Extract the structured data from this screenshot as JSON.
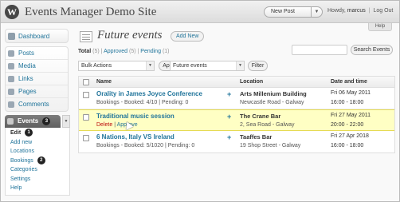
{
  "header": {
    "site_title": "Events Manager Demo Site",
    "new_post": "New Post",
    "howdy_prefix": "Howdy,",
    "username": "marcus",
    "logout": "Log Out",
    "help": "Help"
  },
  "sidebar": {
    "dashboard": "Dashboard",
    "items": [
      {
        "label": "Posts"
      },
      {
        "label": "Media"
      },
      {
        "label": "Links"
      },
      {
        "label": "Pages"
      },
      {
        "label": "Comments"
      }
    ],
    "events": {
      "label": "Events",
      "badge": "3"
    },
    "submenu": [
      {
        "label": "Edit",
        "badge": "1"
      },
      {
        "label": "Add new"
      },
      {
        "label": "Locations"
      },
      {
        "label": "Bookings",
        "badge": "2"
      },
      {
        "label": "Categories"
      },
      {
        "label": "Settings"
      },
      {
        "label": "Help"
      }
    ]
  },
  "main": {
    "title": "Future events",
    "add_new": "Add New",
    "filters": {
      "total": "Total",
      "total_count": "(5)",
      "approved": "Approved",
      "approved_count": "(5)",
      "pending": "Pending",
      "pending_count": "(1)"
    },
    "search_button": "Search Events",
    "bulk_actions": "Bulk Actions",
    "apply": "Apply",
    "scope": "Future events",
    "filter": "Filter",
    "columns": {
      "name": "Name",
      "location": "Location",
      "datetime": "Date and time"
    },
    "rows": [
      {
        "name": "Orality in James Joyce Conference",
        "actions": "Bookings - Booked: 4/10 | Pending: 0",
        "location_name": "Arts Millenium Building",
        "location_addr": "Newcastle Road - Galway",
        "date": "Fri 06 May 2011",
        "time": "16:00 - 18:00"
      },
      {
        "name": "Traditional music session",
        "delete": "Delete",
        "approve": "Approve",
        "location_name": "The Crane Bar",
        "location_addr": "2, Sea Road - Galway",
        "date": "Fri 27 May 2011",
        "time": "20:00 - 22:00"
      },
      {
        "name": "6 Nations, Italy VS Ireland",
        "actions": "Bookings - Booked: 5/1020 | Pending: 0",
        "location_name": "Taaffes Bar",
        "location_addr": "19 Shop Street - Galway",
        "date": "Fri 27 Apr 2018",
        "time": "16:00 - 18:00"
      }
    ]
  }
}
